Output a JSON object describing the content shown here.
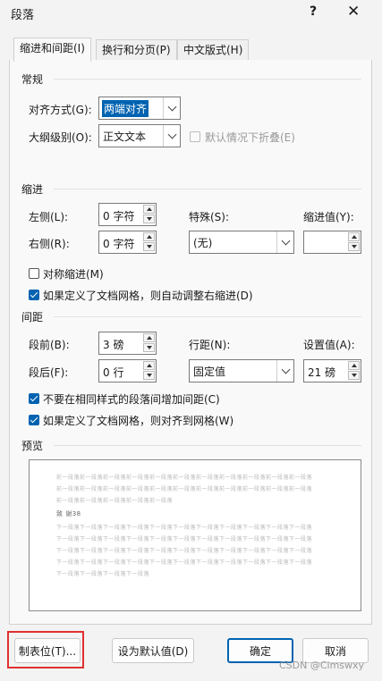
{
  "window": {
    "title": "段落",
    "help": "?",
    "close": "✕"
  },
  "tabs": [
    {
      "label": "缩进和间距(I)"
    },
    {
      "label": "换行和分页(P)"
    },
    {
      "label": "中文版式(H)"
    }
  ],
  "general": {
    "header": "常规",
    "alignment_label": "对齐方式(G):",
    "alignment_value": "两端对齐",
    "outline_label": "大纲级别(O):",
    "outline_value": "正文文本",
    "collapse_label": "默认情况下折叠(E)"
  },
  "indent": {
    "header": "缩进",
    "left_label": "左侧(L):",
    "left_value": "0 字符",
    "right_label": "右侧(R):",
    "right_value": "0 字符",
    "special_label": "特殊(S):",
    "special_value": "(无)",
    "indent_value_label": "缩进值(Y):",
    "indent_value": "",
    "mirror_label": "对称缩进(M)",
    "mirror_checked": false,
    "auto_adjust_label": "如果定义了文档网格，则自动调整右缩进(D)",
    "auto_adjust_checked": true
  },
  "spacing": {
    "header": "间距",
    "before_label": "段前(B):",
    "before_value": "3 磅",
    "after_label": "段后(F):",
    "after_value": "0 行",
    "line_label": "行距(N):",
    "line_value": "固定值",
    "at_label": "设置值(A):",
    "at_value": "21 磅",
    "no_space_label": "不要在相同样式的段落间增加间距(C)",
    "no_space_checked": true,
    "snap_grid_label": "如果定义了文档网格，则对齐到网格(W)",
    "snap_grid_checked": true
  },
  "preview": {
    "header": "预览",
    "lines": [
      "前一段落前一段落前一段落前一段落前一段落前一段落前一段落前一段落前一段落前一段落前一段落",
      "前一段落前一段落前一段落前一段落前一段落前一段落前一段落前一段落前一段落前一段落前一段落",
      "前一段落前一段落前一段落前一段落前一段落",
      "致 谢38",
      "下一段落下一段落下一段落下一段落下一段落下一段落下一段落下一段落下一段落下一段落下一段落",
      "下一段落下一段落下一段落下一段落下一段落下一段落下一段落下一段落下一段落下一段落下一段落",
      "下一段落下一段落下一段落下一段落下一段落下一段落下一段落下一段落下一段落下一段落下一段落",
      "下一段落下一段落下一段落下一段落下一段落下一段落下一段落下一段落下一段落下一段落下一段落",
      "下一段落下一段落下一段落下一段落"
    ]
  },
  "footer": {
    "tabs_button": "制表位(T)...",
    "default_button": "设为默认值(D)",
    "ok_button": "确定",
    "cancel_button": "取消",
    "watermark": "CSDN @Cimswxy"
  }
}
